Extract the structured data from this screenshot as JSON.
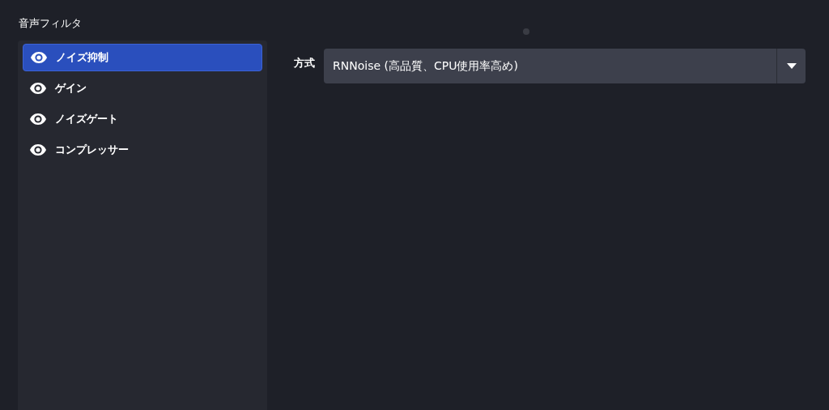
{
  "section_title": "音声フィルタ",
  "filters": [
    {
      "label": "ノイズ抑制",
      "visible": true,
      "selected": true
    },
    {
      "label": "ゲイン",
      "visible": true,
      "selected": false
    },
    {
      "label": "ノイズゲート",
      "visible": true,
      "selected": false
    },
    {
      "label": "コンプレッサー",
      "visible": true,
      "selected": false
    }
  ],
  "settings": {
    "method_label": "方式",
    "method_value": "RNNoise (高品質、CPU使用率高め)"
  }
}
